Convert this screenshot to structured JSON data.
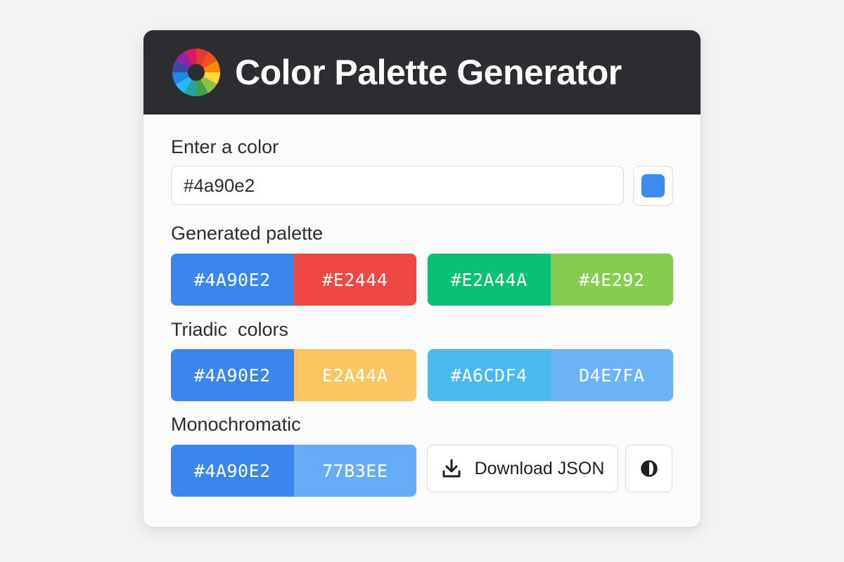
{
  "app": {
    "title": "Color Palette Generator",
    "logo_icon": "color-wheel-icon"
  },
  "input": {
    "label": "Enter a color",
    "value": "#4a90e2",
    "picker_color": "#3d8af0"
  },
  "sections": {
    "generated_label": "Generated palette",
    "triadic_label": "Triadic  colors",
    "mono_label": "Monochromatic"
  },
  "palettes": {
    "generated": [
      [
        {
          "text": "#4A90E2",
          "color": "#3a86ee"
        },
        {
          "text": "#E2444",
          "color": "#ef4743"
        }
      ],
      [
        {
          "text": "#E2A44A",
          "color": "#08c175"
        },
        {
          "text": "#4E292",
          "color": "#86cc50"
        }
      ]
    ],
    "triadic": [
      [
        {
          "text": "#4A90E2",
          "color": "#3a86ee"
        },
        {
          "text": "E2A44A",
          "color": "#fbc562"
        }
      ],
      [
        {
          "text": "#A6CDF4",
          "color": "#4ab9f0"
        },
        {
          "text": "D4E7FA",
          "color": "#6cb2f7"
        }
      ]
    ],
    "monochromatic": [
      [
        {
          "text": "#4A90E2",
          "color": "#3a86ee"
        },
        {
          "text": "77B3EE",
          "color": "#66acf7"
        }
      ]
    ]
  },
  "actions": {
    "download_label": "Download JSON",
    "download_icon": "download-icon",
    "theme_icon": "contrast-icon"
  }
}
